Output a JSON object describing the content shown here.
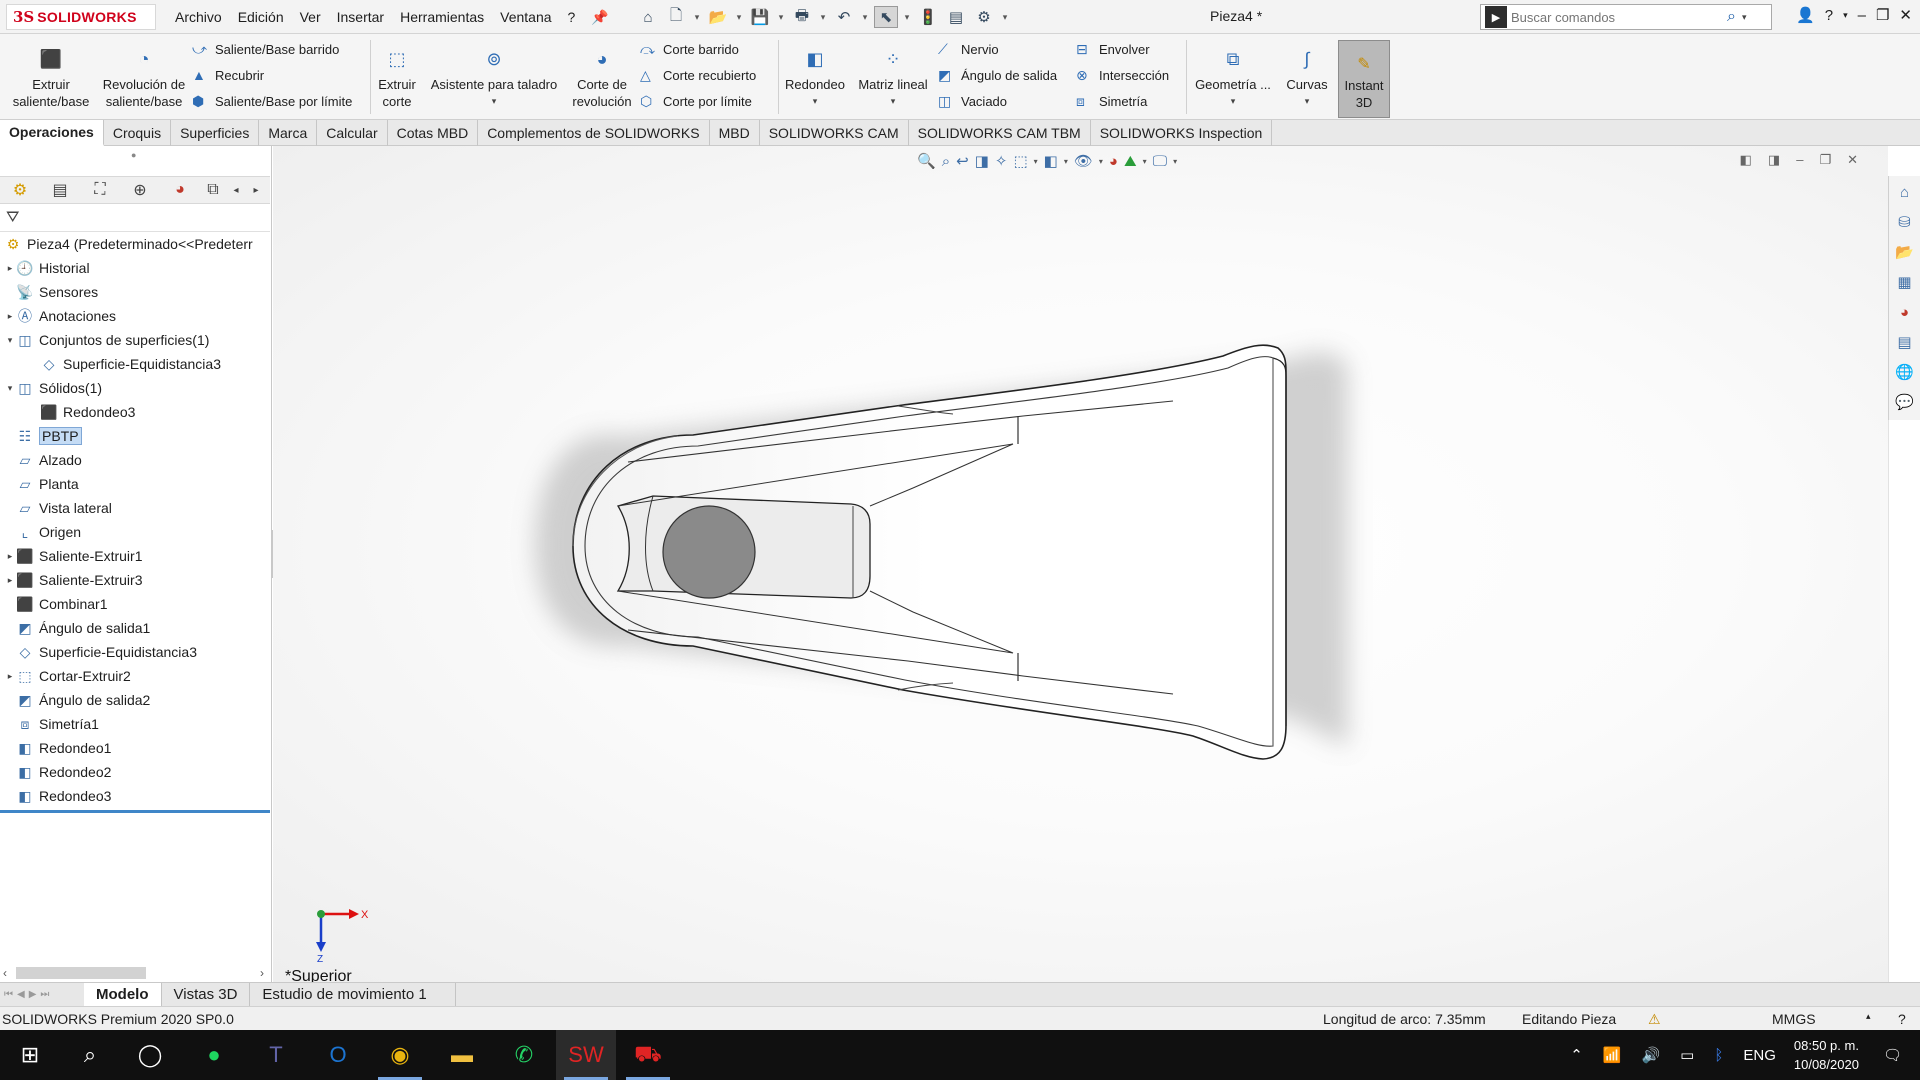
{
  "app": {
    "logo_ds": "3S",
    "logo_text": "SOLIDWORKS",
    "doc_title": "Pieza4 *"
  },
  "menu": [
    "Archivo",
    "Edición",
    "Ver",
    "Insertar",
    "Herramientas",
    "Ventana",
    "?"
  ],
  "search": {
    "placeholder": "Buscar comandos"
  },
  "commands": {
    "extrude": [
      "Extruir",
      "saliente/base"
    ],
    "revolve": [
      "Revolución de",
      "saliente/base"
    ],
    "swept_boss": "Saliente/Base barrido",
    "loft": "Recubrir",
    "boundary_boss": "Saliente/Base por límite",
    "extrude_cut": [
      "Extruir",
      "corte"
    ],
    "hole_wizard": "Asistente para taladro",
    "revolve_cut": [
      "Corte de",
      "revolución"
    ],
    "swept_cut": "Corte barrido",
    "lofted_cut": "Corte recubierto",
    "boundary_cut": "Corte por límite",
    "fillet": "Redondeo",
    "linear_pattern": "Matriz lineal",
    "rib": "Nervio",
    "draft": "Ángulo de salida",
    "shell": "Vaciado",
    "wrap": "Envolver",
    "intersect": "Intersección",
    "mirror": "Simetría",
    "ref_geometry": "Geometría ...",
    "curves": "Curvas",
    "instant3d": [
      "Instant",
      "3D"
    ]
  },
  "tabs": [
    "Operaciones",
    "Croquis",
    "Superficies",
    "Marca",
    "Calcular",
    "Cotas MBD",
    "Complementos de SOLIDWORKS",
    "MBD",
    "SOLIDWORKS CAM",
    "SOLIDWORKS CAM TBM",
    "SOLIDWORKS Inspection"
  ],
  "tree": {
    "root": "Pieza4  (Predeterminado<<Predeterr",
    "items": [
      {
        "label": "Historial",
        "icon": "history-icon",
        "exp": "▸",
        "indent": 0
      },
      {
        "label": "Sensores",
        "icon": "sensors-icon",
        "exp": "",
        "indent": 0
      },
      {
        "label": "Anotaciones",
        "icon": "annotations-icon",
        "exp": "▸",
        "indent": 0
      },
      {
        "label": "Conjuntos de superficies(1)",
        "icon": "surface-bodies-icon",
        "exp": "▾",
        "indent": 0
      },
      {
        "label": "Superficie-Equidistancia3",
        "icon": "surface-icon",
        "exp": "",
        "indent": 1
      },
      {
        "label": "Sólidos(1)",
        "icon": "solid-bodies-icon",
        "exp": "▾",
        "indent": 0
      },
      {
        "label": "Redondeo3",
        "icon": "body-icon",
        "exp": "",
        "indent": 1
      },
      {
        "label": "PBTP",
        "icon": "material-icon",
        "exp": "",
        "indent": 0,
        "selected": true
      },
      {
        "label": "Alzado",
        "icon": "plane-icon",
        "exp": "",
        "indent": 0
      },
      {
        "label": "Planta",
        "icon": "plane-icon",
        "exp": "",
        "indent": 0
      },
      {
        "label": "Vista lateral",
        "icon": "plane-icon",
        "exp": "",
        "indent": 0
      },
      {
        "label": "Origen",
        "icon": "origin-icon",
        "exp": "",
        "indent": 0
      },
      {
        "label": "Saliente-Extruir1",
        "icon": "extrude-icon",
        "exp": "▸",
        "indent": 0
      },
      {
        "label": "Saliente-Extruir3",
        "icon": "extrude-icon",
        "exp": "▸",
        "indent": 0
      },
      {
        "label": "Combinar1",
        "icon": "combine-icon",
        "exp": "",
        "indent": 0
      },
      {
        "label": "Ángulo de salida1",
        "icon": "draft-icon",
        "exp": "",
        "indent": 0
      },
      {
        "label": "Superficie-Equidistancia3",
        "icon": "offset-surface-icon",
        "exp": "",
        "indent": 0
      },
      {
        "label": "Cortar-Extruir2",
        "icon": "cut-extrude-icon",
        "exp": "▸",
        "indent": 0
      },
      {
        "label": "Ángulo de salida2",
        "icon": "draft-icon",
        "exp": "",
        "indent": 0
      },
      {
        "label": "Simetría1",
        "icon": "mirror-icon",
        "exp": "",
        "indent": 0
      },
      {
        "label": "Redondeo1",
        "icon": "fillet-icon",
        "exp": "",
        "indent": 0
      },
      {
        "label": "Redondeo2",
        "icon": "fillet-icon",
        "exp": "",
        "indent": 0
      },
      {
        "label": "Redondeo3",
        "icon": "fillet-icon",
        "exp": "",
        "indent": 0
      }
    ]
  },
  "viewport": {
    "view_label": "*Superior",
    "axis_x": "X",
    "axis_z": "Z"
  },
  "bottom_tabs": [
    "Modelo",
    "Vistas 3D",
    "Estudio de movimiento 1"
  ],
  "status": {
    "product": "SOLIDWORKS Premium 2020 SP0.0",
    "measure": "Longitud de arco: 7.35mm",
    "mode": "Editando Pieza",
    "units": "MMGS"
  },
  "taskbar": {
    "lang": "ENG",
    "time": "08:50 p. m.",
    "date": "10/08/2020"
  },
  "colors": {
    "brand": "#d0021b",
    "accent": "#3f86c8",
    "selection": "#c5dcf5"
  }
}
